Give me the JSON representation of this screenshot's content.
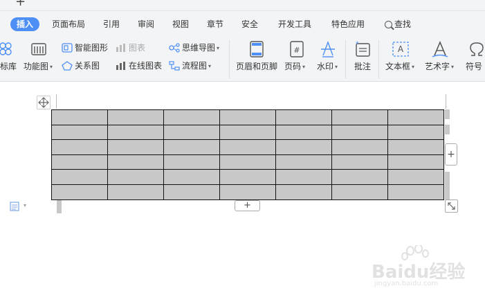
{
  "tabbar": {
    "new_tab_symbol": "+"
  },
  "menu": {
    "tabs": [
      {
        "label": "插入",
        "active": true
      },
      {
        "label": "页面布局"
      },
      {
        "label": "引用"
      },
      {
        "label": "审阅"
      },
      {
        "label": "视图"
      },
      {
        "label": "章节"
      },
      {
        "label": "安全"
      },
      {
        "label": "开发工具"
      },
      {
        "label": "特色应用"
      },
      {
        "label": "查找"
      }
    ],
    "accent_color": "#4e8ff5"
  },
  "ribbon": {
    "partial_left_label": "标库",
    "function_chart": "功能图",
    "smart_graphic": "智能图形",
    "chart": "图表",
    "mind_map": "思维导图",
    "relation_chart": "关系图",
    "online_chart": "在线图表",
    "flow_chart": "流程图",
    "header_footer": "页眉和页脚",
    "page_number": "页码",
    "watermark": "水印",
    "comment": "批注",
    "text_box": "文本框",
    "word_art": "艺术字",
    "symbol": "符号",
    "page_number_glyph": "#"
  },
  "document": {
    "table": {
      "rows": 6,
      "cols": 7,
      "cell_fill": "#c8c8c8"
    },
    "add_symbol": "+"
  },
  "watermark_overlay": {
    "brand": "Baidu经验",
    "url": "jingyan.baidu.com"
  }
}
